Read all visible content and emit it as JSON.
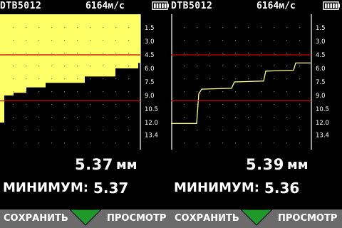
{
  "colors": {
    "fill": "#ffff66",
    "gate": "#cc0000",
    "trace": "#ffff88",
    "softbar": "#6b6b6b",
    "arrow": "#1f9a2a"
  },
  "icons": [
    "battery-icon",
    "down-arrow-icon"
  ],
  "panes": [
    {
      "id": "left",
      "header": {
        "model": "DTB5012",
        "velocity": "6164м/с"
      },
      "plot": {
        "style": "filled",
        "scale": [
          "1.5",
          "3.0",
          "4.5",
          "6.0",
          "7.5",
          "9.0",
          "10.5",
          "12.0",
          "13.4"
        ],
        "depth_range": [
          0,
          15
        ],
        "gates": [
          4.5,
          9.6
        ],
        "steps": [
          [
            0,
            12.0
          ],
          [
            6,
            9.0
          ],
          [
            19,
            8.7
          ],
          [
            37,
            8.1
          ],
          [
            64,
            7.6
          ],
          [
            119,
            6.9
          ],
          [
            162,
            6.0
          ],
          [
            194,
            5.4
          ]
        ]
      },
      "readout": {
        "value": "5.37",
        "unit": "мм"
      },
      "minimum": {
        "label": "МИНИМУМ:",
        "value": "5.37"
      },
      "softkeys": {
        "left": "СОХРАНИТЬ",
        "right": "ПРОСМОТР"
      }
    },
    {
      "id": "right",
      "header": {
        "model": "DTB5012",
        "velocity": "6164м/с"
      },
      "plot": {
        "style": "line",
        "scale": [
          "1.5",
          "3.0",
          "4.5",
          "6.0",
          "7.5",
          "9.0",
          "10.5",
          "12.0",
          "13.4"
        ],
        "depth_range": [
          0,
          15
        ],
        "gates": [
          4.5,
          9.6
        ],
        "steps": [
          [
            0,
            12.1
          ],
          [
            36,
            12.1
          ],
          [
            39,
            8.8
          ],
          [
            43,
            8.3
          ],
          [
            85,
            8.2
          ],
          [
            89,
            7.5
          ],
          [
            130,
            7.4
          ],
          [
            133,
            6.3
          ],
          [
            172,
            6.2
          ],
          [
            175,
            5.4
          ],
          [
            196,
            5.4
          ]
        ]
      },
      "readout": {
        "value": "5.39",
        "unit": "мм"
      },
      "minimum": {
        "label": "МИНИМУМ:",
        "value": "5.36"
      },
      "softkeys": {
        "left": "СОХРАНИТЬ",
        "right": "ПРОСМОТР"
      }
    }
  ]
}
